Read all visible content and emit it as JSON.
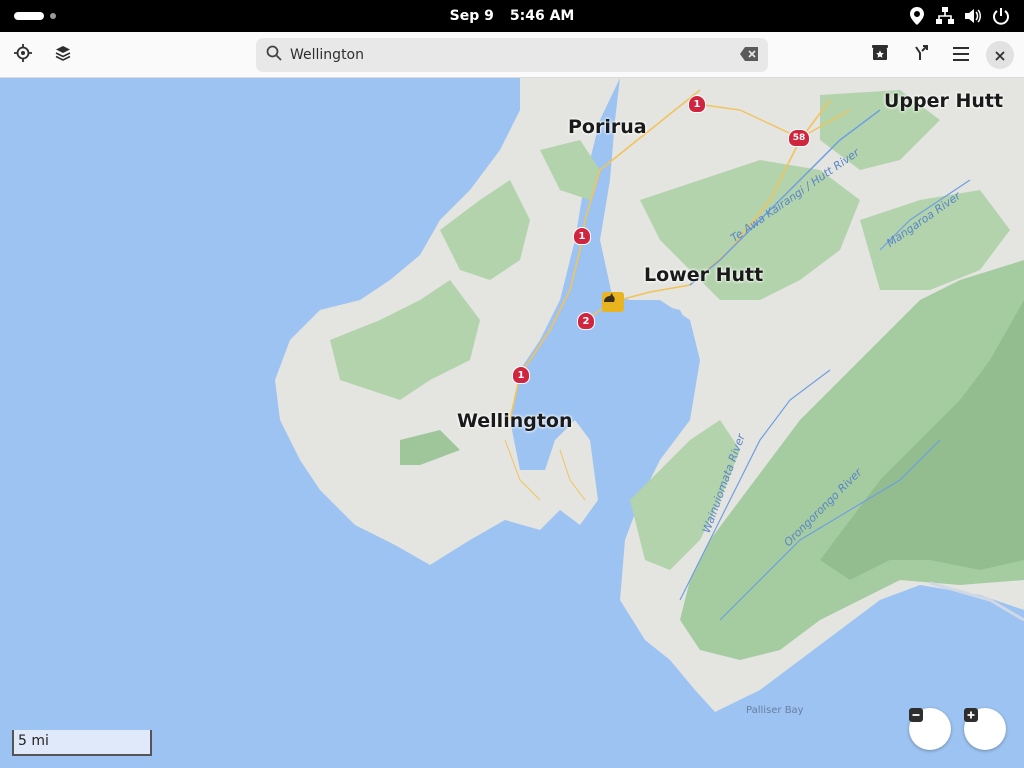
{
  "topbar": {
    "date": "Sep 9",
    "time": "5:46 AM",
    "icons": [
      "location-icon",
      "network-icon",
      "volume-icon",
      "power-icon"
    ]
  },
  "headerbar": {
    "search_value": "Wellington",
    "search_placeholder": "Wellington",
    "left_icons": [
      "my-location-icon",
      "layers-icon"
    ],
    "right_icons": [
      "favorites-icon",
      "route-icon",
      "menu-icon",
      "close-icon"
    ]
  },
  "map": {
    "cities": [
      {
        "name": "Upper Hutt"
      },
      {
        "name": "Porirua"
      },
      {
        "name": "Lower Hutt"
      },
      {
        "name": "Wellington"
      }
    ],
    "rivers": [
      "Te Awa Kairangi / Hutt River",
      "Mangaroa River",
      "Wainuiomata River",
      "Orongorongo River"
    ],
    "bay": "Palliser Bay",
    "highways": [
      "1",
      "58",
      "1",
      "2",
      "1"
    ],
    "scale": "5 mi",
    "colors": {
      "water": "#9cc3f1",
      "land": "#e4e4e1",
      "park": "#b3d3ad",
      "highway": "#d0253e"
    }
  }
}
